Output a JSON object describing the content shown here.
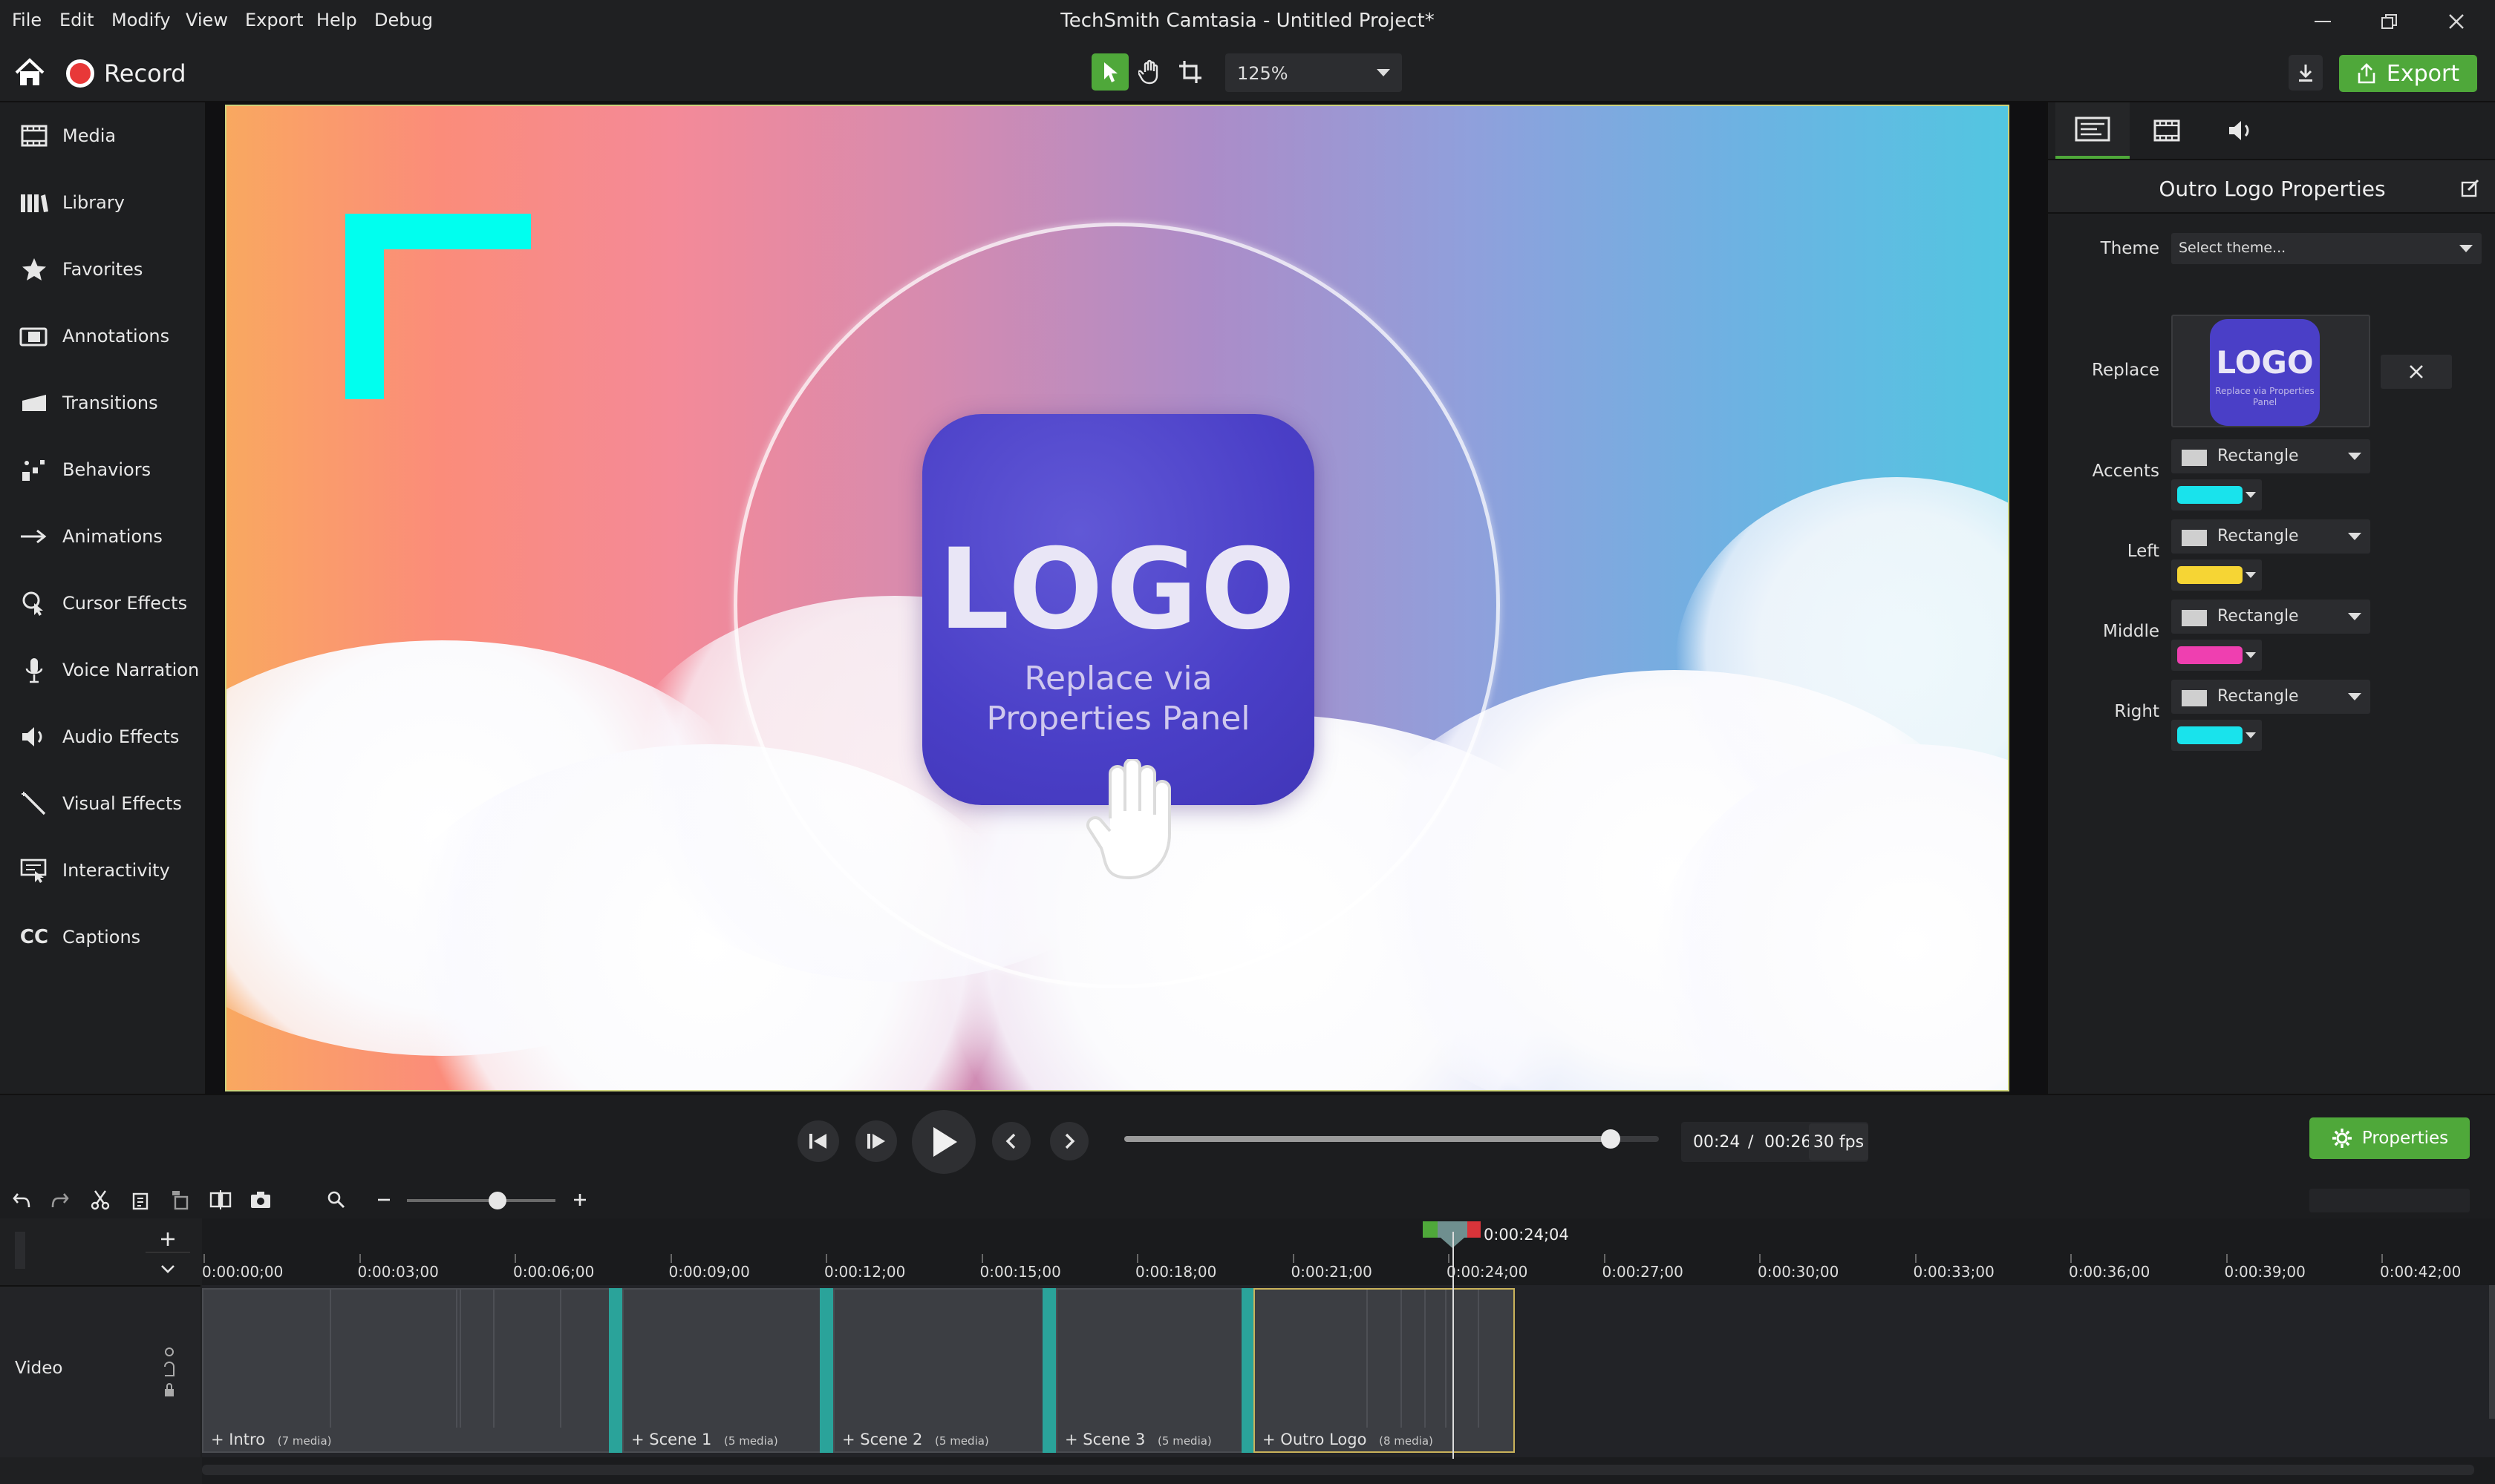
{
  "app": {
    "title": "TechSmith Camtasia - Untitled Project*",
    "menu": [
      "File",
      "Edit",
      "Modify",
      "View",
      "Export",
      "Help",
      "Debug"
    ]
  },
  "toolbar": {
    "record_label": "Record",
    "zoom_value": "125%",
    "export_label": "Export"
  },
  "sidebar": {
    "items": [
      {
        "label": "Media",
        "icon": "media-icon"
      },
      {
        "label": "Library",
        "icon": "library-icon"
      },
      {
        "label": "Favorites",
        "icon": "star-icon"
      },
      {
        "label": "Annotations",
        "icon": "annotation-icon"
      },
      {
        "label": "Transitions",
        "icon": "transition-icon"
      },
      {
        "label": "Behaviors",
        "icon": "behaviors-icon"
      },
      {
        "label": "Animations",
        "icon": "animation-icon"
      },
      {
        "label": "Cursor Effects",
        "icon": "cursor-effects-icon"
      },
      {
        "label": "Voice Narration",
        "icon": "microphone-icon"
      },
      {
        "label": "Audio Effects",
        "icon": "speaker-icon"
      },
      {
        "label": "Visual Effects",
        "icon": "magic-wand-icon"
      },
      {
        "label": "Interactivity",
        "icon": "interactivity-icon"
      },
      {
        "label": "Captions",
        "icon": "cc-icon"
      }
    ]
  },
  "canvas": {
    "logo_text": "LOGO",
    "logo_sub_line1": "Replace via",
    "logo_sub_line2": "Properties Panel",
    "accent_color": "#00ffef"
  },
  "properties": {
    "title": "Outro Logo Properties",
    "theme_label": "Theme",
    "theme_value": "Select theme...",
    "replace_label": "Replace",
    "thumb_text": "LOGO",
    "thumb_sub": "Replace via Properties Panel",
    "rows": [
      {
        "label": "Accents",
        "shape": "Rectangle",
        "color": "#19e3ec"
      },
      {
        "label": "Left",
        "shape": "Rectangle",
        "color": "#f6d534"
      },
      {
        "label": "Middle",
        "shape": "Rectangle",
        "color": "#ef3fb0"
      },
      {
        "label": "Right",
        "shape": "Rectangle",
        "color": "#19e3ec"
      }
    ]
  },
  "playback": {
    "current": "00:24",
    "separator": "/",
    "duration": "00:26",
    "fps": "30 fps",
    "progress": 0.91,
    "properties_label": "Properties"
  },
  "timeline": {
    "playhead_time": "0:00:24;04",
    "ruler": [
      "0:00:00;00",
      "0:00:03;00",
      "0:00:06;00",
      "0:00:09;00",
      "0:00:12;00",
      "0:00:15;00",
      "0:00:18;00",
      "0:00:21;00",
      "0:00:24;00",
      "0:00:27;00",
      "0:00:30;00",
      "0:00:33;00",
      "0:00:36;00",
      "0:00:39;00",
      "0:00:42;00"
    ],
    "track_label": "Video",
    "clips": [
      {
        "name": "Intro",
        "count": "(7 media)"
      },
      {
        "name": "Scene 1",
        "count": "(5 media)"
      },
      {
        "name": "Scene 2",
        "count": "(5 media)"
      },
      {
        "name": "Scene 3",
        "count": "(5 media)"
      },
      {
        "name": "Outro Logo",
        "count": "(8 media)"
      }
    ]
  }
}
